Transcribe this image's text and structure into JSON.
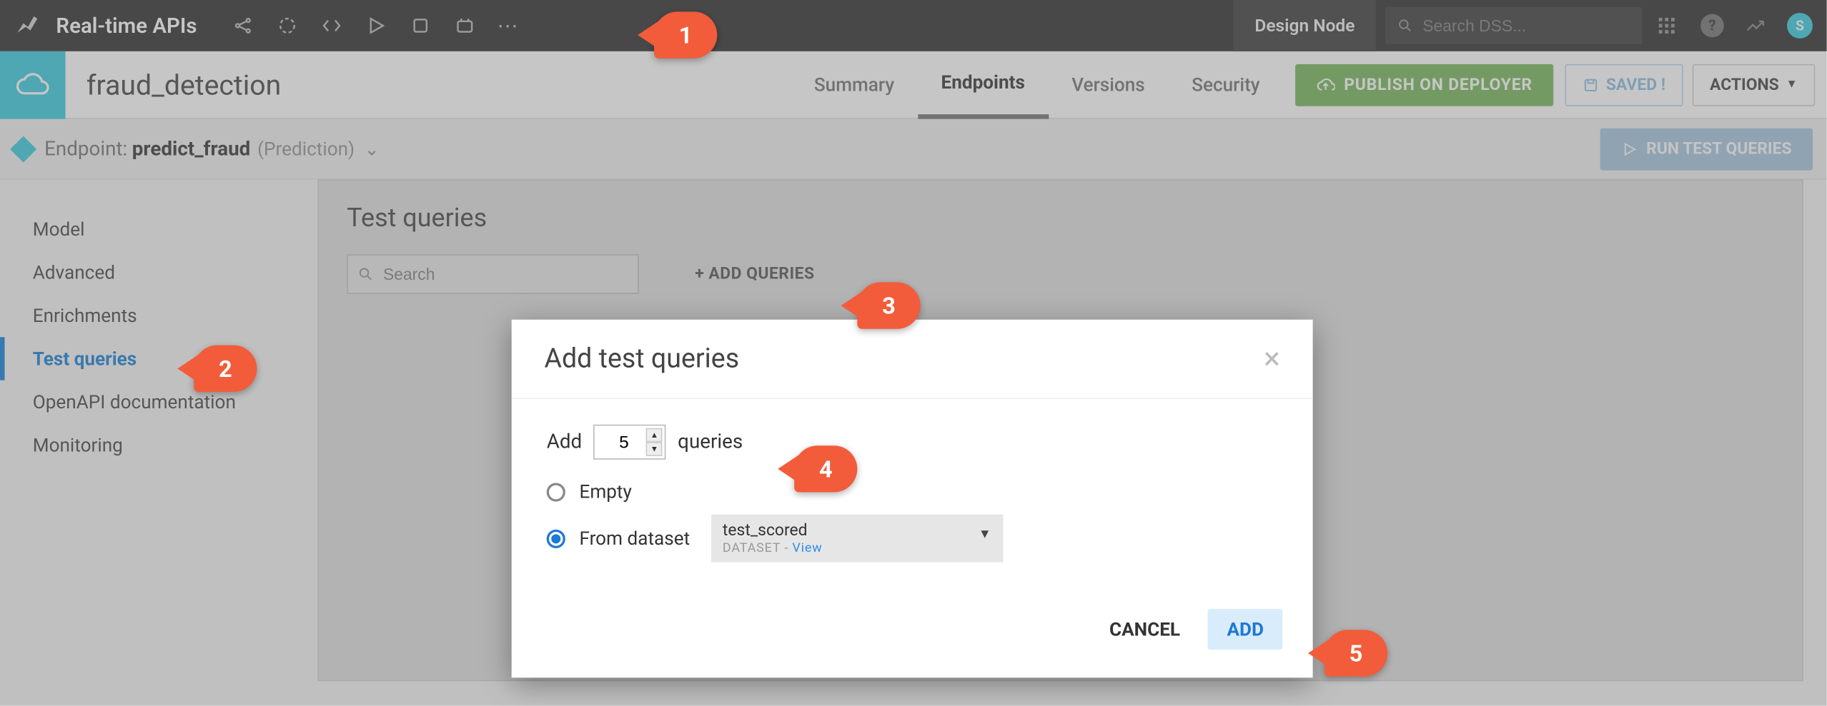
{
  "topnav": {
    "app_title": "Real-time APIs",
    "design_node": "Design Node",
    "search_placeholder": "Search DSS...",
    "avatar_letter": "S"
  },
  "project": {
    "name": "fraud_detection",
    "tabs": [
      "Summary",
      "Endpoints",
      "Versions",
      "Security"
    ],
    "active_tab": "Endpoints",
    "publish_label": "PUBLISH ON DEPLOYER",
    "saved_label": "SAVED !",
    "actions_label": "ACTIONS"
  },
  "endpoint": {
    "prefix": "Endpoint:",
    "name": "predict_fraud",
    "type": "(Prediction)",
    "run_test_label": "RUN TEST QUERIES"
  },
  "sidebar": {
    "items": [
      "Model",
      "Advanced",
      "Enrichments",
      "Test queries",
      "OpenAPI documentation",
      "Monitoring"
    ],
    "active": "Test queries"
  },
  "panel": {
    "heading": "Test queries",
    "search_placeholder": "Search",
    "add_queries_label": "+ ADD QUERIES"
  },
  "modal": {
    "title": "Add test queries",
    "add_prefix": "Add",
    "count_value": "5",
    "add_suffix": "queries",
    "option_empty": "Empty",
    "option_from_dataset": "From dataset",
    "dataset_name": "test_scored",
    "dataset_sub_prefix": "DATASET",
    "dataset_view": "View",
    "cancel_label": "CANCEL",
    "add_label": "ADD"
  },
  "annotations": {
    "b1": "1",
    "b2": "2",
    "b3": "3",
    "b4": "4",
    "b5": "5"
  }
}
